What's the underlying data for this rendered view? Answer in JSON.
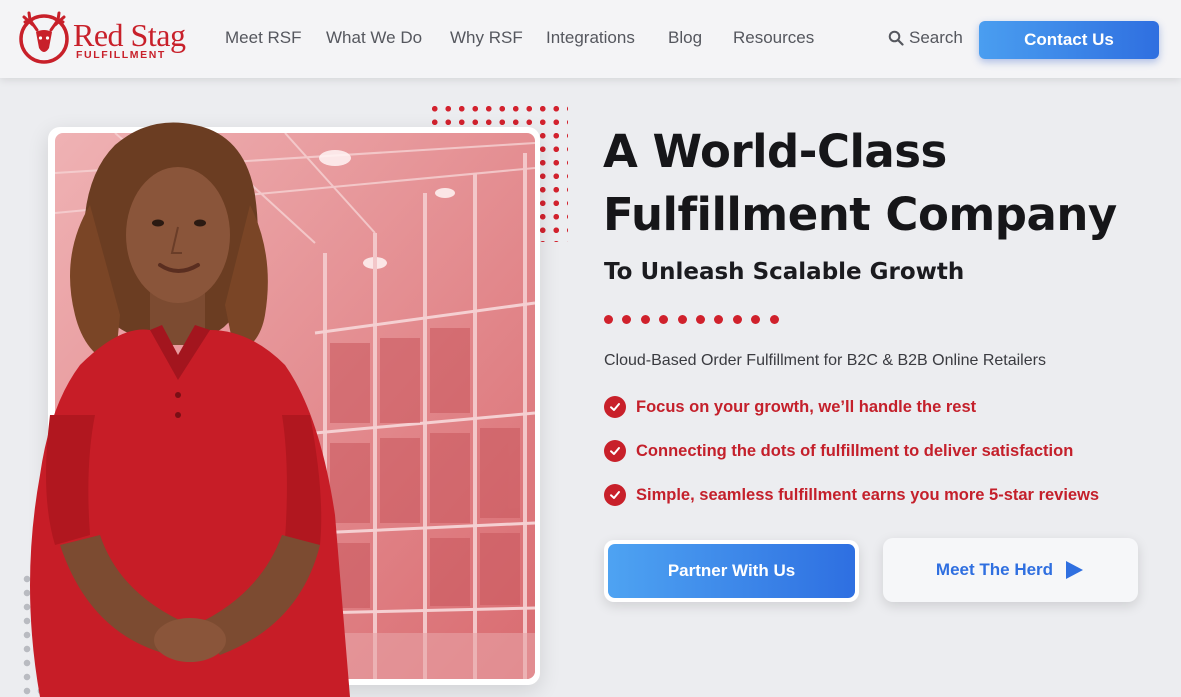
{
  "brand": {
    "name": "Red Stag",
    "sub": "FULFILLMENT",
    "color": "#c8202a",
    "icon": "stag-head-icon"
  },
  "nav": {
    "items": [
      "Meet RSF",
      "What We Do",
      "Why RSF",
      "Integrations",
      "Blog",
      "Resources"
    ],
    "search_label": "Search",
    "search_icon": "search-icon",
    "contact_label": "Contact Us"
  },
  "hero": {
    "title_line1": "A World-Class",
    "title_line2": "Fulfillment Company",
    "subtitle": "To Unleash Scalable Growth",
    "tagline": "Cloud-Based Order Fulfillment for B2C & B2B Online Retailers",
    "features": [
      "Focus on your growth, we’ll handle the rest",
      "Connecting the dots of fulfillment to deliver satisfaction",
      "Simple, seamless fulfillment earns you more 5-star reviews"
    ],
    "feature_icon": "check-circle-icon",
    "partner_button": "Partner With Us",
    "herd_button": "Meet The Herd",
    "herd_icon": "play-arrow-icon"
  },
  "colors": {
    "accent_blue": "#2f6fe0",
    "accent_red": "#c8202a",
    "page_bg": "#ecedf0"
  }
}
